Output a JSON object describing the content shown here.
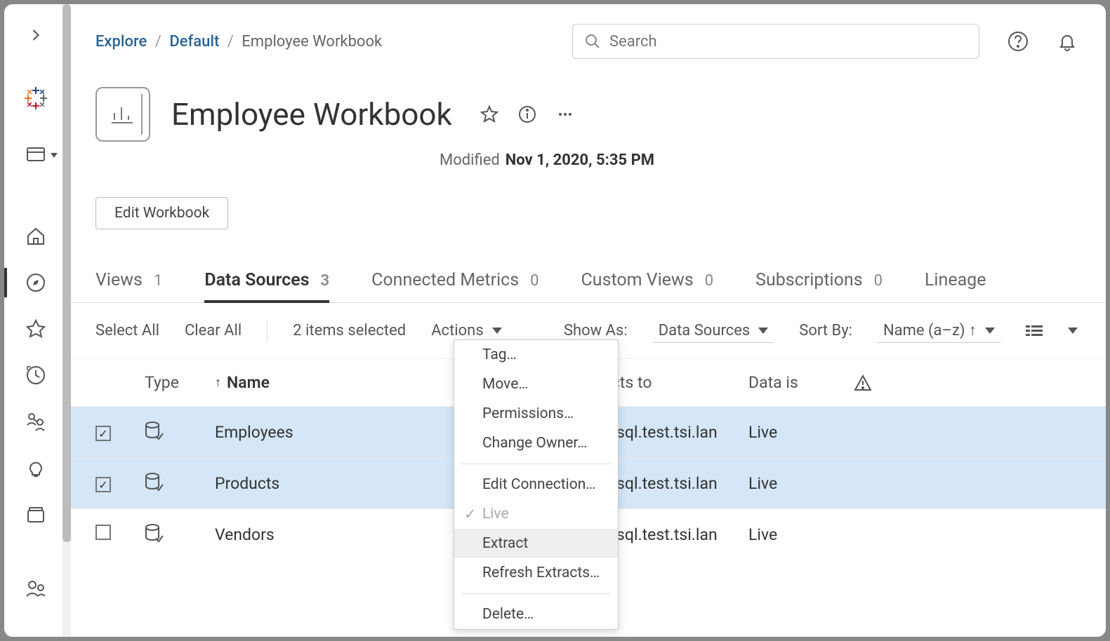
{
  "breadcrumb": {
    "root": "Explore",
    "project": "Default",
    "current": "Employee Workbook"
  },
  "search": {
    "placeholder": "Search"
  },
  "title": "Employee Workbook",
  "modified": {
    "label": "Modified",
    "value": "Nov 1, 2020, 5:35 PM"
  },
  "edit_button": "Edit Workbook",
  "tabs": [
    {
      "label": "Views",
      "count": "1"
    },
    {
      "label": "Data Sources",
      "count": "3"
    },
    {
      "label": "Connected Metrics",
      "count": "0"
    },
    {
      "label": "Custom Views",
      "count": "0"
    },
    {
      "label": "Subscriptions",
      "count": "0"
    },
    {
      "label": "Lineage",
      "count": ""
    }
  ],
  "toolbar": {
    "select_all": "Select All",
    "clear_all": "Clear All",
    "selected": "2 items selected",
    "actions": "Actions",
    "show_as_label": "Show As:",
    "show_as_value": "Data Sources",
    "sort_by_label": "Sort By:",
    "sort_by_value": "Name (a–z) ↑"
  },
  "columns": {
    "type": "Type",
    "name": "Name",
    "connects": "nects to",
    "datais": "Data is"
  },
  "rows": [
    {
      "selected": true,
      "name": "Employees",
      "connects": "mssql.test.tsi.lan",
      "datais": "Live"
    },
    {
      "selected": true,
      "name": "Products",
      "connects": "mssql.test.tsi.lan",
      "datais": "Live"
    },
    {
      "selected": false,
      "name": "Vendors",
      "connects": "mssql.test.tsi.lan",
      "datais": "Live"
    }
  ],
  "menu": {
    "tag": "Tag…",
    "move": "Move…",
    "permissions": "Permissions…",
    "change_owner": "Change Owner…",
    "edit_connection": "Edit Connection…",
    "live": "Live",
    "extract": "Extract",
    "refresh": "Refresh Extracts…",
    "delete": "Delete…"
  }
}
